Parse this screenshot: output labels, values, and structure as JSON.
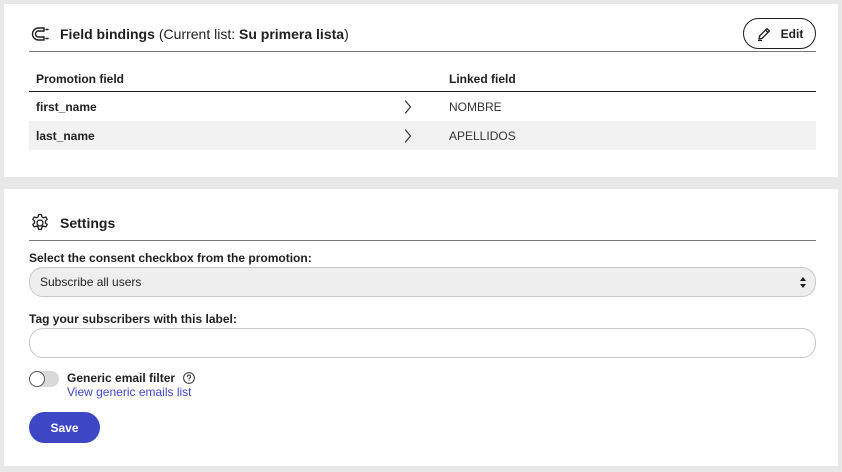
{
  "bindings": {
    "title": "Field bindings",
    "subtitle_prefix": "(Current list: ",
    "list_name": "Su primera lista",
    "subtitle_suffix": ")",
    "edit_label": "Edit",
    "columns": {
      "promotion": "Promotion field",
      "linked": "Linked field"
    },
    "rows": [
      {
        "promotion": "first_name",
        "linked": "NOMBRE"
      },
      {
        "promotion": "last_name",
        "linked": "APELLIDOS"
      }
    ]
  },
  "settings": {
    "title": "Settings",
    "consent_label": "Select the consent checkbox from the promotion:",
    "consent_value": "Subscribe all users",
    "tag_label": "Tag your subscribers with this label:",
    "tag_value": "",
    "filter_label": "Generic email filter",
    "filter_enabled": false,
    "generic_link": "View generic emails list",
    "save_label": "Save"
  },
  "colors": {
    "accent": "#3d47c6",
    "page_background": "#e8e8e8",
    "row_alt": "#f2f2f2"
  },
  "icons": {
    "bindings": "magnet-icon",
    "edit": "pencil-icon",
    "row_arrow": "chevron-right-icon",
    "settings": "gear-icon",
    "help": "help-circle-icon",
    "select": "select-arrows-icon"
  }
}
